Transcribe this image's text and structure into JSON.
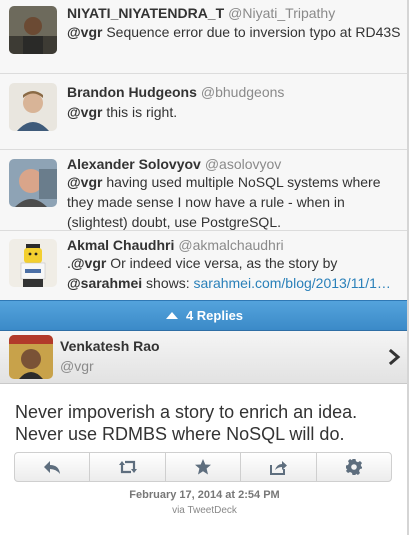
{
  "replies": [
    {
      "name": "NIYATI_NIYATENDRA_T",
      "handle": "@Niyati_Tripathy",
      "mention": "@vgr",
      "text": " Sequence error due to inversion typo at RD43S",
      "avatar_icon": "person-avatar-dark"
    },
    {
      "name": "Brandon Hudgeons",
      "handle": "@bhudgeons",
      "mention": "@vgr",
      "text": " this is right.",
      "avatar_icon": "person-avatar-smiling"
    },
    {
      "name": "Alexander Solovyov",
      "handle": "@asolovyov",
      "mention": "@vgr",
      "text": " having used multiple NoSQL systems where they made sense I now have a rule - when in (slightest) doubt, use PostgreSQL.",
      "avatar_icon": "person-avatar-bald"
    },
    {
      "name": "Akmal Chaudhri",
      "handle": "@akmalchaudhri",
      "prefix": ".",
      "mention": "@vgr",
      "text": " Or indeed vice versa, as the story by ",
      "mention2": "@sarahmei",
      "text2": " shows: ",
      "link": "sarahmei.com/blog/2013/11/1…",
      "avatar_icon": "lego-figure-avatar"
    }
  ],
  "replies_bar": {
    "label": "4 Replies",
    "icon": "chevron-up-icon"
  },
  "focus_tweet": {
    "name": "Venkatesh Rao",
    "handle": "@vgr",
    "avatar_icon": "person-avatar-magazine",
    "text": "Never impoverish a story to enrich an idea. Never use RDMBS where NoSQL will do.",
    "actions": [
      "reply-icon",
      "retweet-icon",
      "favorite-icon",
      "share-icon",
      "gear-icon"
    ],
    "timestamp": "February 17, 2014 at 2:54 PM",
    "via": "via TweetDeck"
  },
  "colors": {
    "link": "#2a80b9",
    "replies_bar": "#4597d3"
  }
}
